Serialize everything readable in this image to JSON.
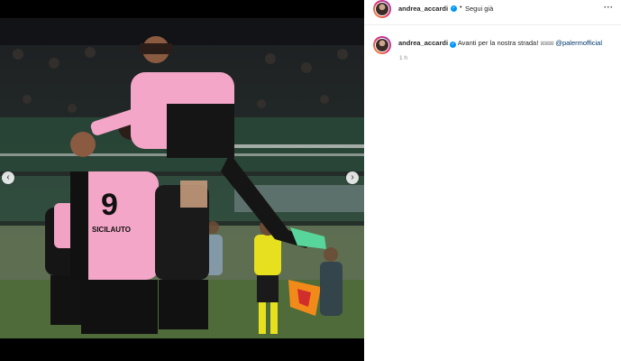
{
  "post": {
    "author": "andrea_accardi",
    "follow_label": "Segui già",
    "more_label": "···",
    "caption": {
      "text": "Avanti per la nostra strada!",
      "emoji_placeholders": "⊠⊠⊠",
      "mention": "@palermofficial"
    },
    "time_ago": "1 h"
  },
  "media": {
    "prev_label": "‹",
    "next_label": "›",
    "photo_description_icon": "football-celebration-photo",
    "jersey": {
      "number": "9",
      "sponsor": "SICILAUTO"
    }
  },
  "colors": {
    "verified_blue": "#0095f6",
    "mention_link": "#00376b",
    "secondary_text": "#8e8e8e",
    "palermo_pink": "#f4a6c8",
    "palermo_black": "#111111"
  }
}
